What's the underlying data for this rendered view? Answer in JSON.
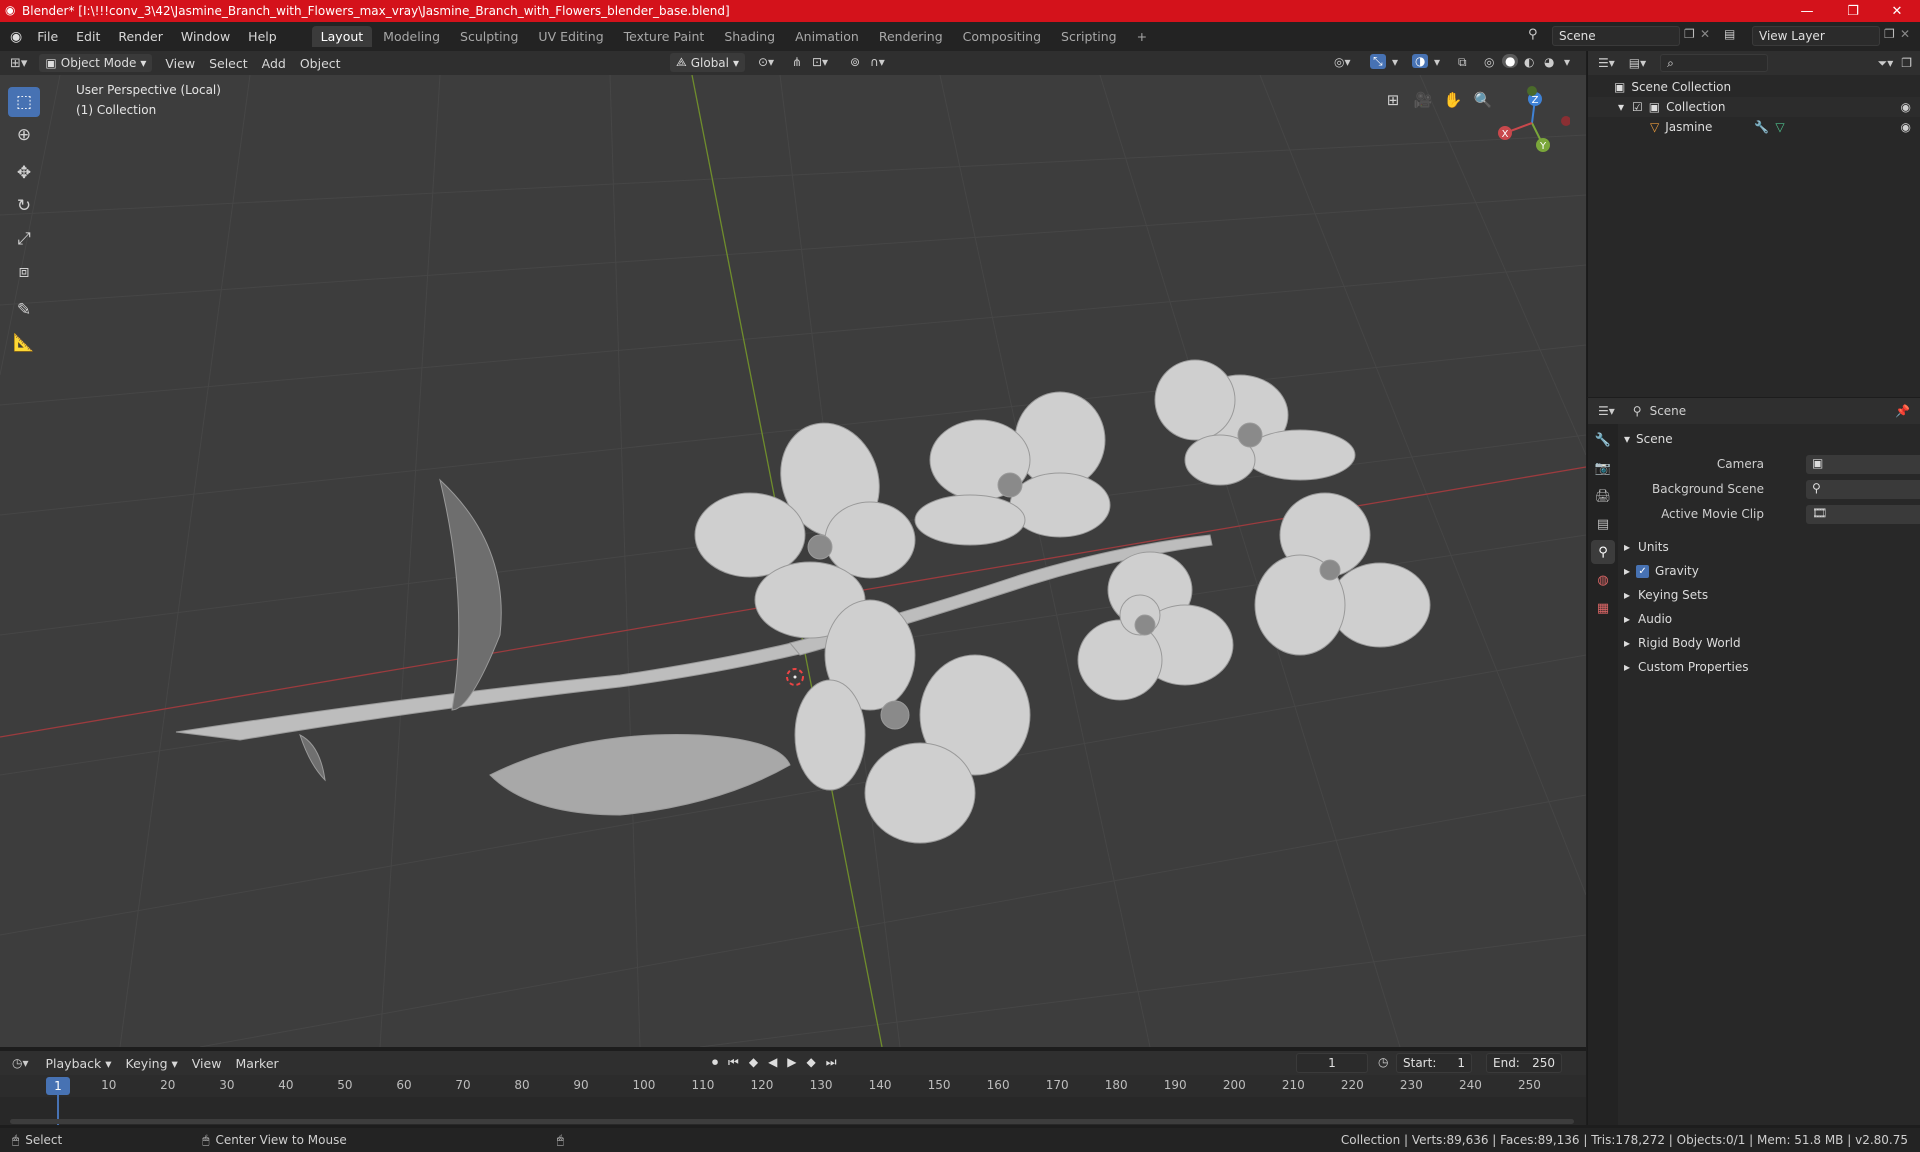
{
  "window": {
    "title": "Blender* [I:\\!!!conv_3\\42\\Jasmine_Branch_with_Flowers_max_vray\\Jasmine_Branch_with_Flowers_blender_base.blend]",
    "minimize": "—",
    "maximize": "❐",
    "close": "✕"
  },
  "menus": [
    "File",
    "Edit",
    "Render",
    "Window",
    "Help"
  ],
  "workspaces": [
    "Layout",
    "Modeling",
    "Sculpting",
    "UV Editing",
    "Texture Paint",
    "Shading",
    "Animation",
    "Rendering",
    "Compositing",
    "Scripting"
  ],
  "add_workspace": "+",
  "scene_selector": {
    "value": "Scene"
  },
  "viewlayer_selector": {
    "value": "View Layer"
  },
  "viewport_header": {
    "mode": "Object Mode",
    "menus": [
      "View",
      "Select",
      "Add",
      "Object"
    ],
    "transform_orientation": "Global"
  },
  "viewport": {
    "perspective_label": "User Perspective (Local)",
    "collection_label": "(1) Collection",
    "gizmo": {
      "x": "X",
      "y": "Y",
      "z": "Z"
    }
  },
  "outliner": {
    "root": "Scene Collection",
    "collection": "Collection",
    "object": "Jasmine",
    "search_placeholder": ""
  },
  "properties": {
    "header": "Scene",
    "panel_title": "Scene",
    "fields": [
      {
        "label": "Camera",
        "value": ""
      },
      {
        "label": "Background Scene",
        "value": ""
      },
      {
        "label": "Active Movie Clip",
        "value": ""
      }
    ],
    "sections": [
      "Units",
      "Gravity",
      "Keying Sets",
      "Audio",
      "Rigid Body World",
      "Custom Properties"
    ],
    "gravity_checked": true
  },
  "timeline": {
    "menus": [
      "Playback",
      "Keying",
      "View",
      "Marker"
    ],
    "current_frame": "1",
    "start_label": "Start:",
    "start": "1",
    "end_label": "End:",
    "end": "250",
    "ticks": [
      "1",
      "10",
      "20",
      "30",
      "40",
      "50",
      "60",
      "70",
      "80",
      "90",
      "100",
      "110",
      "120",
      "130",
      "140",
      "150",
      "160",
      "170",
      "180",
      "190",
      "200",
      "210",
      "220",
      "230",
      "240",
      "250"
    ]
  },
  "statusbar": {
    "select": "Select",
    "center_view": "Center View to Mouse",
    "stats": "Collection | Verts:89,636 | Faces:89,136 | Tris:178,272 | Objects:0/1 | Mem: 51.8 MB | v2.80.75"
  },
  "colors": {
    "title_bar": "#d4121b",
    "active_tool": "#4772b3",
    "axis_x": "#c8484c",
    "axis_y": "#7aa63a",
    "axis_z": "#3f82d6"
  }
}
